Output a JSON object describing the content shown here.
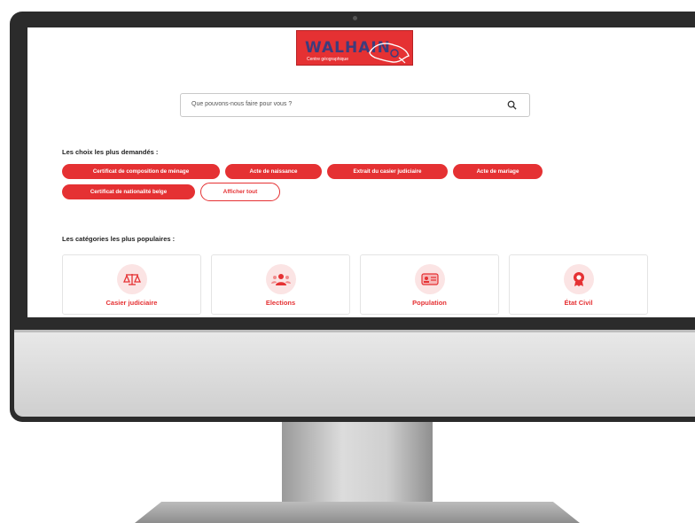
{
  "site": {
    "logo": {
      "title": "WALHAIN",
      "subtitle": "Centre géographique"
    },
    "search": {
      "placeholder": "Que pouvons-nous faire pour vous ?"
    },
    "popular_choices": {
      "heading": "Les choix les plus demandés :",
      "items": [
        "Certificat de composition de ménage",
        "Acte de naissance",
        "Extrait du casier judiciaire",
        "Acte de mariage",
        "Certificat de nationalité belge"
      ],
      "show_all_label": "Afficher tout"
    },
    "popular_categories": {
      "heading": "Les catégories les plus populaires :",
      "items": [
        {
          "label": "Casier judiciaire",
          "icon": "scales-icon"
        },
        {
          "label": "Elections",
          "icon": "people-icon"
        },
        {
          "label": "Population",
          "icon": "id-card-icon"
        },
        {
          "label": "État Civil",
          "icon": "award-icon"
        }
      ]
    },
    "colors": {
      "accent": "#e53133",
      "logo_text": "#3d3c7c",
      "icon_bg": "#fbe4e4"
    }
  }
}
